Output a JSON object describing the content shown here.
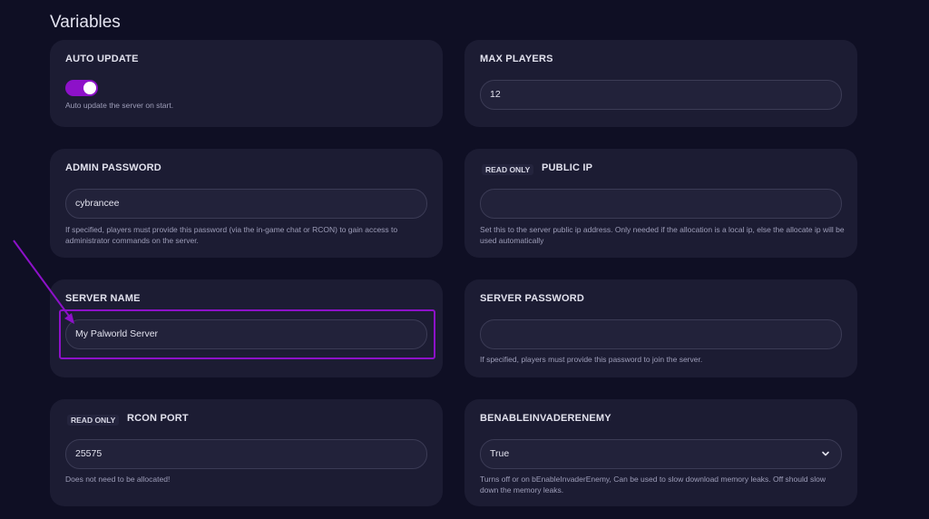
{
  "section_title": "Variables",
  "read_only_badge": "READ ONLY",
  "cards": {
    "auto_update": {
      "label": "AUTO UPDATE",
      "enabled": true,
      "help": "Auto update the server on start."
    },
    "max_players": {
      "label": "MAX PLAYERS",
      "value": "12"
    },
    "admin_password": {
      "label": "ADMIN PASSWORD",
      "value": "cybrancee",
      "help": "If specified, players must provide this password (via the in-game chat or RCON) to gain access to administrator commands on the server."
    },
    "public_ip": {
      "label": "PUBLIC IP",
      "value": "",
      "help": "Set this to the server public ip address. Only needed if the allocation is a local ip, else the allocate ip will be used automatically"
    },
    "server_name": {
      "label": "SERVER NAME",
      "value": "My Palworld Server"
    },
    "server_password": {
      "label": "SERVER PASSWORD",
      "value": "",
      "help": "If specified, players must provide this password to join the server."
    },
    "rcon_port": {
      "label": "RCON PORT",
      "value": "25575",
      "help": "Does not need to be allocated!"
    },
    "invader_enemy": {
      "label": "BENABLEINVADERENEMY",
      "value": "True",
      "help": "Turns off or on bEnableInvaderEnemy, Can be used to slow download memory leaks. Off should slow down the memory leaks."
    }
  },
  "colors": {
    "accent": "#8d11c9",
    "background": "#0f0f24",
    "card": "#1c1c33"
  }
}
